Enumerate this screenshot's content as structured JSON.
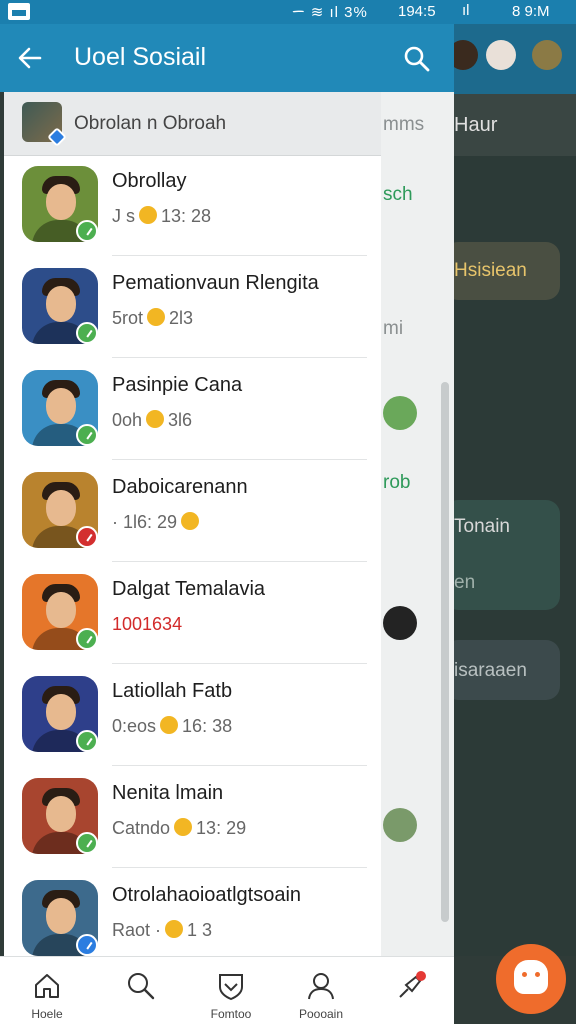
{
  "status_bar": {
    "sys_icons": "ᯇ ≋ ıl 3%",
    "time": "194:5",
    "sys_icons_right": "ıl",
    "time_right": "8 9:M"
  },
  "app_bar": {
    "title": "Uoel Sosiail"
  },
  "group": {
    "label": "Obrolan n Obroah"
  },
  "chats": [
    {
      "name": "Obrollay",
      "preview_a": "J  s",
      "preview_b": "13: 28",
      "status_color": "#4caf50",
      "accent": "#6c8f3a"
    },
    {
      "name": "Pemationvaun Rlengita",
      "preview_a": "5rot",
      "preview_b": "2l3",
      "status_color": "#4caf50",
      "accent": "#2d4d8a"
    },
    {
      "name": "Pasinpie Cana",
      "preview_a": "0oh",
      "preview_b": "3l6",
      "status_color": "#4caf50",
      "accent": "#3a8fc4"
    },
    {
      "name": "Daboicarenann",
      "preview_a": "· 1l6: 29",
      "preview_b": "",
      "status_color": "#d32f2f",
      "accent": "#b9832e"
    },
    {
      "name": "Dalgat Temalavia",
      "preview_red": "1001634",
      "status_color": "#4caf50",
      "accent": "#e5762a"
    },
    {
      "name": "Latiollah Fatb",
      "preview_a": "0:eos",
      "preview_b": "16: 38",
      "status_color": "#4caf50",
      "accent": "#2e3f8a"
    },
    {
      "name": "Nenita lmain",
      "preview_a": "Catndo",
      "preview_b": "13: 29",
      "status_color": "#4caf50",
      "accent": "#a8452f"
    },
    {
      "name": "Otrolahaoioatlgtsoain",
      "preview_a": "Raot ·",
      "preview_b": "1 3",
      "status_color": "#2b7de0",
      "accent": "#3d6a8c"
    }
  ],
  "background": {
    "strip_texts": [
      "mms",
      "sch",
      "mi",
      "rob"
    ],
    "header_text": "Haur",
    "card_texts": [
      "Hsisiean",
      "Tonain",
      "en",
      "isaraaen"
    ]
  },
  "bottom_nav": [
    {
      "label": "Hoele",
      "icon": "home-icon"
    },
    {
      "label": "",
      "icon": "search-icon"
    },
    {
      "label": "Fomtoo",
      "icon": "shield-icon"
    },
    {
      "label": "Poooain",
      "icon": "profile-icon"
    },
    {
      "label": "",
      "icon": "rocket-icon"
    }
  ],
  "colors": {
    "app_bar": "#2189b8",
    "status_bar": "#1b7fae",
    "fab": "#ef6c2c"
  }
}
